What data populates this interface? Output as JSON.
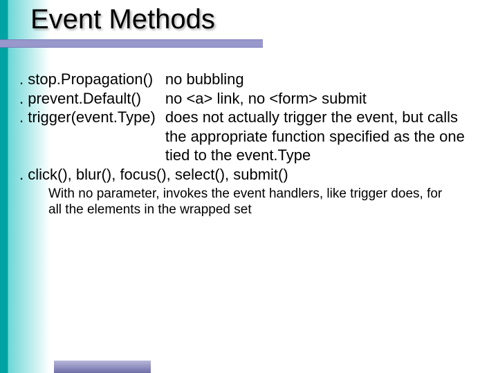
{
  "title": "Event Methods",
  "rows": [
    {
      "method": ". stop.Propagation()",
      "desc": "no bubbling"
    },
    {
      "method": ". prevent.Default()",
      "desc": "no <a> link, no <form> submit"
    },
    {
      "method": ". trigger(event.Type)",
      "desc": "does not actually trigger the event, but calls the appropriate function specified as the one tied to the event.Type"
    }
  ],
  "full_line": ". click(), blur(), focus(), select(), submit()",
  "note": "With no parameter, invokes the event handlers, like trigger does, for all the elements in the wrapped set"
}
